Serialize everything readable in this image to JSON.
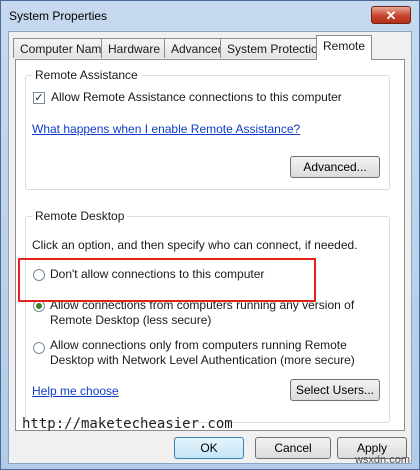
{
  "window": {
    "title": "System Properties",
    "close_glyph": "✕"
  },
  "tabs": [
    {
      "label": "Computer Name"
    },
    {
      "label": "Hardware"
    },
    {
      "label": "Advanced"
    },
    {
      "label": "System Protection"
    },
    {
      "label": "Remote",
      "active": true
    }
  ],
  "remote_assistance": {
    "group_title": "Remote Assistance",
    "allow_label": "Allow Remote Assistance connections to this computer",
    "allow_checked": true,
    "help_link": "What happens when I enable Remote Assistance?",
    "advanced_button": "Advanced..."
  },
  "remote_desktop": {
    "group_title": "Remote Desktop",
    "instructions": "Click an option, and then specify who can connect, if needed.",
    "options": [
      {
        "label": "Don't allow connections to this computer",
        "selected": false
      },
      {
        "label_line1": "Allow connections from computers running any version of",
        "label_line2": "Remote Desktop (less secure)",
        "selected": true
      },
      {
        "label_line1": "Allow connections only from computers running Remote",
        "label_line2": "Desktop with Network Level Authentication (more secure)",
        "selected": false
      }
    ],
    "help_link": "Help me choose",
    "select_users_button": "Select Users..."
  },
  "footer": {
    "ok_button": "OK",
    "cancel_button": "Cancel",
    "apply_button": "Apply"
  },
  "watermark": "http://maketecheasier.com",
  "corner_watermark": "wsxdn.com",
  "colors": {
    "highlight": "#e2231a",
    "link": "#0f3cc9",
    "radio_selected": "#3a7d24"
  }
}
